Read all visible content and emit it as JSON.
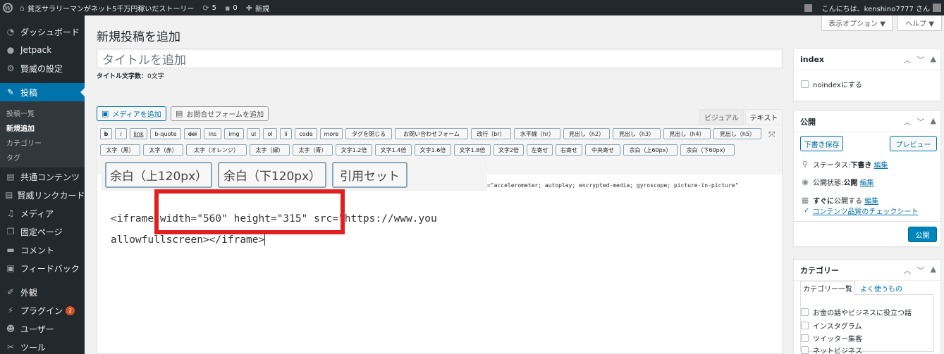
{
  "adminbar": {
    "site_name": "貧乏サラリーマンがネット5千万円稼いだストーリー",
    "updates_count": "5",
    "comments_count": "0",
    "new_label": "新規",
    "greeting": "こんにちは、kenshino7777 さん"
  },
  "sidebar": {
    "items_top": [
      {
        "label": "ダッシュボード",
        "icon": "dashboard-icon"
      },
      {
        "label": "Jetpack",
        "icon": "jetpack-icon"
      },
      {
        "label": "賢威の設定",
        "icon": "gear-icon"
      }
    ],
    "current": {
      "label": "投稿",
      "icon": "pin-icon"
    },
    "submenu": [
      "投稿一覧",
      "新規追加",
      "カテゴリー",
      "タグ"
    ],
    "items_bottom": [
      {
        "label": "共通コンテンツ",
        "icon": "page-icon"
      },
      {
        "label": "賢威リンクカード",
        "icon": "page-icon"
      },
      {
        "label": "メディア",
        "icon": "media-icon"
      },
      {
        "label": "固定ページ",
        "icon": "pages-icon"
      },
      {
        "label": "コメント",
        "icon": "comment-icon"
      },
      {
        "label": "フィードバック",
        "icon": "feedback-icon"
      }
    ],
    "items_lower": [
      {
        "label": "外観",
        "icon": "brush-icon"
      },
      {
        "label": "プラグイン",
        "icon": "plugin-icon",
        "badge": "2"
      },
      {
        "label": "ユーザー",
        "icon": "user-icon"
      },
      {
        "label": "ツール",
        "icon": "wrench-icon"
      }
    ]
  },
  "header": {
    "page_title": "新規投稿を追加",
    "screen_options": "表示オプション ▼",
    "help": "ヘルプ ▼"
  },
  "title_field": {
    "placeholder": "タイトルを追加",
    "count_label": "タイトル文字数：",
    "count_value": "0文字"
  },
  "media": {
    "add_media": "メディアを追加",
    "add_form": "お問合せフォームを追加"
  },
  "editor_tabs": {
    "visual": "ビジュアル",
    "text": "テキスト"
  },
  "quicktags_row1": [
    "b",
    "i",
    "link",
    "b-quote",
    "del",
    "ins",
    "img",
    "ul",
    "ol",
    "li",
    "code",
    "more",
    "タグを閉じる",
    "お問い合わせフォーム",
    "改行（br）",
    "水平線（hr）",
    "見出し（h2）",
    "見出し（h3）",
    "見出し（h4）",
    "見出し（h5）"
  ],
  "quicktags_row2": [
    "太字（黒）",
    "太字（赤）",
    "太字（オレンジ）",
    "太字（緑）",
    "太字（青）",
    "文字1.2倍",
    "文字1.4倍",
    "文字1.6倍",
    "文字1.8倍",
    "文字2倍",
    "左寄せ",
    "右寄せ",
    "中央寄せ",
    "余白（上60px）",
    "余白（下60px）"
  ],
  "zoom": {
    "buttons": [
      "余白（上120px）",
      "余白（下120px）",
      "引用セット"
    ],
    "code_line1": "<iframe width=\"560\" height=\"315\" src=\"https://www.you",
    "code_line2": "allowfullscreen></iframe>",
    "code_tail": "=\"accelerometer; autoplay; encrypted-media; gyroscope; picture-in-picture\""
  },
  "index_box": {
    "title": "index",
    "checkbox_label": "noindexにする"
  },
  "publish_box": {
    "title": "公開",
    "save_draft": "下書き保存",
    "preview": "プレビュー",
    "status_label": "ステータス: ",
    "status_value": "下書き",
    "visibility_label": "公開状態: ",
    "visibility_value": "公開",
    "schedule_value": "すぐに",
    "schedule_label": "公開する",
    "edit": "編集",
    "content_check": "コンテンツ品質のチェックシート",
    "publish": "公開"
  },
  "category_box": {
    "title": "カテゴリー",
    "tab_all": "カテゴリー一覧",
    "tab_popular": "よく使うもの",
    "items": [
      "お金の話やビジネスに役立つ話",
      "インスタグラム",
      "ツイッター集客",
      "ネットビジネス"
    ]
  },
  "colors": {
    "accent": "#0073aa",
    "adminbar": "#23282d",
    "highlight_box": "#e02020"
  }
}
